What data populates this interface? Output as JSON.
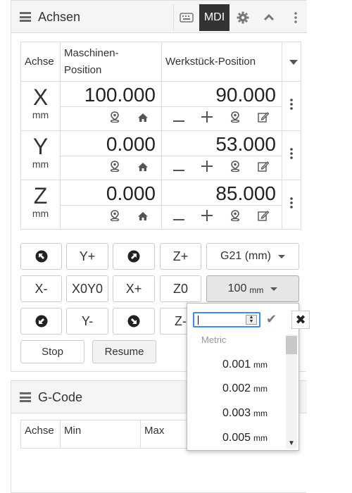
{
  "axes_panel": {
    "title": "Achsen",
    "mdi_label": "MDI",
    "icons": [
      "hamburger-icon",
      "keyboard-icon",
      "gear-icon",
      "chevron-up-icon",
      "vertical-dots-icon"
    ]
  },
  "axes_table": {
    "headers": [
      "Achse",
      "Maschinen-\nPosition",
      "Werkstück-Position"
    ],
    "rows": [
      {
        "axis": "X",
        "unit": "mm",
        "machine": "100.000",
        "work": "90.000"
      },
      {
        "axis": "Y",
        "unit": "mm",
        "machine": "0.000",
        "work": "53.000"
      },
      {
        "axis": "Z",
        "unit": "mm",
        "machine": "0.000",
        "work": "85.000"
      }
    ]
  },
  "jog": {
    "y_plus": "Y+",
    "z_plus": "Z+",
    "units_select": "G21 (mm)",
    "x_minus": "X-",
    "xy_zero": "X0Y0",
    "x_plus": "X+",
    "z_zero": "Z0",
    "step_value": "100",
    "step_unit": "mm",
    "y_minus": "Y-",
    "z_minus": "Z-",
    "stop": "Stop",
    "resume": "Resume"
  },
  "step_popup": {
    "group": "Metric",
    "options": [
      {
        "value": "0.001",
        "unit": "mm"
      },
      {
        "value": "0.002",
        "unit": "mm"
      },
      {
        "value": "0.003",
        "unit": "mm"
      },
      {
        "value": "0.005",
        "unit": "mm"
      }
    ]
  },
  "gcode_panel": {
    "title": "G-Code",
    "headers": [
      "Achse",
      "Min",
      "Max"
    ]
  },
  "colors": {
    "accent": "#3a8ee6",
    "mdi_bg": "#333333"
  }
}
